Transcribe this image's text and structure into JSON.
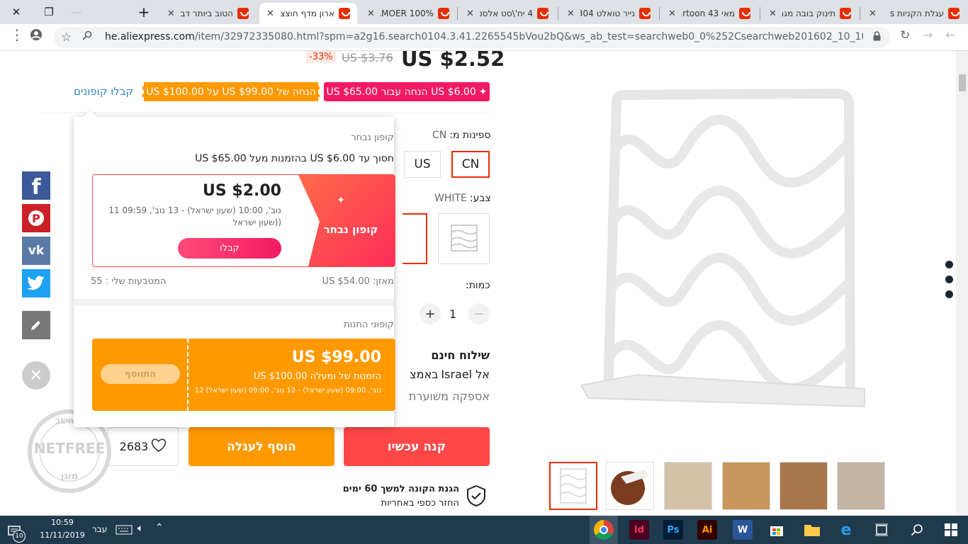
{
  "browser": {
    "tabs": [
      {
        "title": "עגלת הקניות s",
        "active": false
      },
      {
        "title": "תינוק בובה מגנ",
        "active": false
      },
      {
        "title": "מאי 43 Cartoon",
        "active": false
      },
      {
        "title": "נייר טואלט 304",
        "active": false
      },
      {
        "title": "4 יח'\\סט אלסט",
        "active": false
      },
      {
        "title": "BAMOER 100%",
        "active": false
      },
      {
        "title": "ארון מדף חוצצ",
        "active": true
      },
      {
        "title": "הטוב ביותר דב",
        "active": false
      }
    ],
    "url_main": "he.aliexpress.com",
    "url_rest": "/item/32972335080.html?spm=a2g16.search0104.3.41.2265545bVou2bQ&ws_ab_test=searchweb0_0%252Csearchweb201602_10_10065_10068_319_10059..."
  },
  "product": {
    "price": "US $2.52",
    "old_price": "US $3.76",
    "discount": "-33%",
    "store_coupon_badge": "US $6.00 הנחה עבור US $65.00",
    "orange_coupon_badge": "הנחה של US $99.00 על US $100.00",
    "get_coupons_link": "קבלו קופונים",
    "ships_from_label": "ספינות מ:",
    "ships_from_value": "CN",
    "ships_options": [
      "CN",
      "US"
    ],
    "color_label": "צבע:",
    "color_value": "WHITE",
    "quantity_label": "כמות:",
    "quantity_value": "1",
    "free_shipping": "שילוח חינם",
    "shipping_to_prefix": "אל Israel",
    "shipping_to_suffix": "באמצ",
    "delivery_estimate": "אספקה משוערת",
    "buy_now": "קנה עכשיו",
    "add_to_cart": "הוסף לעגלה",
    "wishlist_count": "2683",
    "protection_title": "הגנת הקונה למשך 60 ימים",
    "protection_sub": "החזר כספי באחריות"
  },
  "coupon_popup": {
    "selected_title": "קופון נבחר",
    "selected_desc": "חסוך עד US $6.00 בהזמנות מעל US $65.00",
    "coupon_amount": "US $2.00",
    "coupon_validity": "נוב', 10:00 (שעון ישראל) - 13 נוב', 09:59 11 ((שעון ישראל",
    "coupon_tag": "קופון נבחר",
    "get_button": "קבלו",
    "balance": "מאזן: US $54.00",
    "my_coins": "המטבעות שלי : 55",
    "store_title": "קופוני החנות",
    "store_amount": "US $99.00",
    "store_desc": "הזמנות של ומעלה US $100.00",
    "store_validity": "נוב', 09:00 (שעון ישראל) - 12 נוב', 09:00 (שעון ישראל) 12",
    "store_button": "התווסף"
  },
  "netfree_badge": {
    "top": "מוחשב",
    "mid": "NETFREE",
    "bottom": "מוגן"
  },
  "taskbar": {
    "time": "10:59",
    "date": "11/11/2019",
    "lang": "עבר",
    "notif_count": "10"
  },
  "colors": {
    "accent": "#ff4747",
    "orange": "#ff9900",
    "link": "#2e86c1",
    "pink": "#f31a63"
  }
}
